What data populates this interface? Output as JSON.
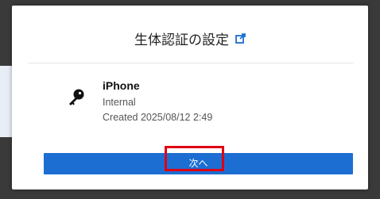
{
  "dialog": {
    "title": "生体認証の設定",
    "title_icon": "external-link-icon",
    "key_icon": "key-icon",
    "device": {
      "name": "iPhone",
      "type": "Internal",
      "created": "Created 2025/08/12 2:49"
    },
    "next_label": "次へ"
  },
  "colors": {
    "accent": "#1c6ed2",
    "highlight": "#e00012"
  }
}
